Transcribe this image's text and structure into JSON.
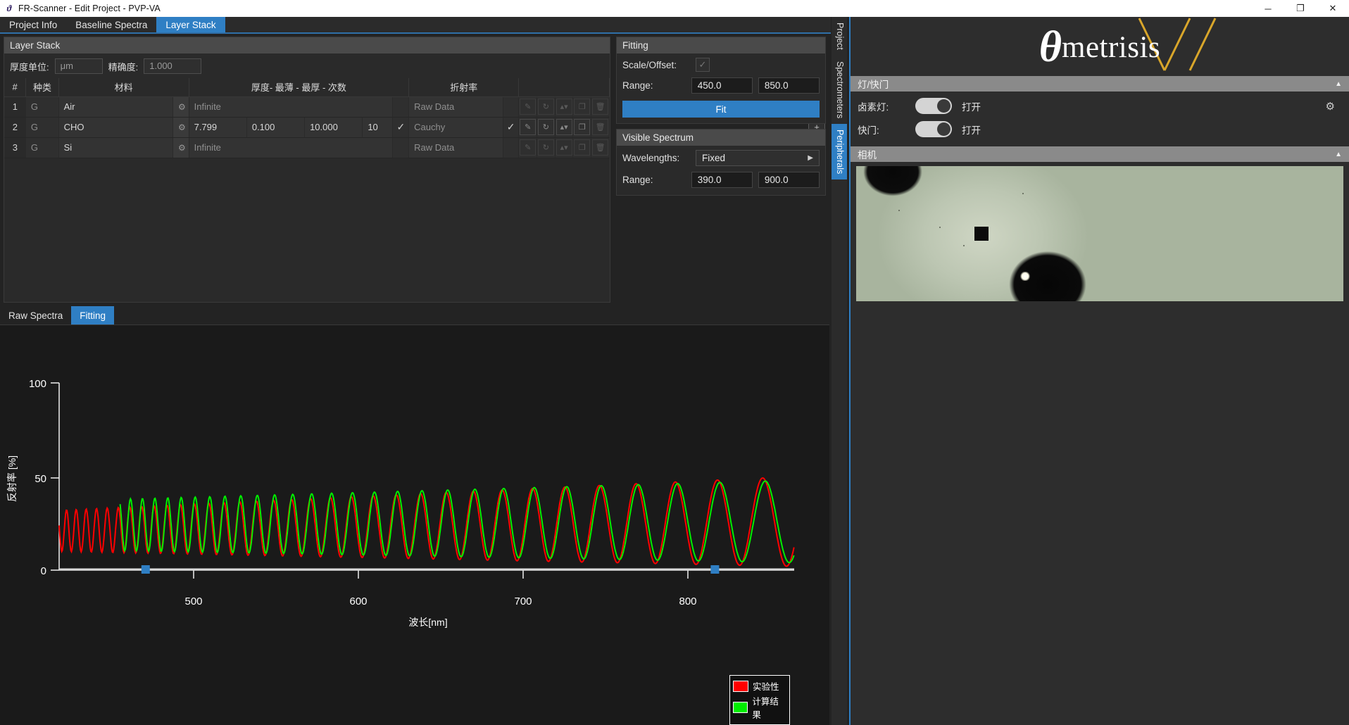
{
  "window": {
    "title": "FR-Scanner - Edit Project - PVP-VA",
    "logo_glyph": "ϑ",
    "minimize": "─",
    "maximize": "❐",
    "close": "✕"
  },
  "tabs": [
    {
      "label": "Project Info",
      "active": false
    },
    {
      "label": "Baseline Spectra",
      "active": false
    },
    {
      "label": "Layer Stack",
      "active": true
    }
  ],
  "layer_stack": {
    "panel_title": "Layer Stack",
    "thickness_unit_label": "厚度单位:",
    "thickness_unit_value": "μm",
    "precision_label": "精确度:",
    "precision_value": "1.000",
    "columns": [
      "#",
      "种类",
      "材料",
      "厚度- 最薄 - 最厚 - 次数",
      "折射率"
    ],
    "rows": [
      {
        "num": "1",
        "kind": "G",
        "material": "Air",
        "thickness": "Infinite",
        "min": "",
        "max": "",
        "count": "",
        "fit_check": false,
        "index": "Raw Data",
        "index_check": false,
        "actions_enabled": false
      },
      {
        "num": "2",
        "kind": "G",
        "material": "CHO",
        "thickness": "7.799",
        "min": "0.100",
        "max": "10.000",
        "count": "10",
        "fit_check": true,
        "index": "Cauchy",
        "index_check": true,
        "actions_enabled": true
      },
      {
        "num": "3",
        "kind": "G",
        "material": "Si",
        "thickness": "Infinite",
        "min": "",
        "max": "",
        "count": "",
        "fit_check": false,
        "index": "Raw Data",
        "index_check": false,
        "actions_enabled": false
      }
    ],
    "row_action_icons": [
      "edit-icon",
      "refresh-icon",
      "spinner-icon",
      "copy-icon",
      "delete-icon"
    ],
    "side_buttons": [
      "add-layer",
      "import-layer",
      "export-layer"
    ]
  },
  "fitting": {
    "title": "Fitting",
    "scale_offset_label": "Scale/Offset:",
    "scale_offset_checked": true,
    "range_label": "Range:",
    "range_min": "450.0",
    "range_max": "850.0",
    "fit_button": "Fit"
  },
  "visible_spectrum": {
    "title": "Visible Spectrum",
    "wavelengths_label": "Wavelengths:",
    "wavelengths_value": "Fixed",
    "range_label": "Range:",
    "range_min": "390.0",
    "range_max": "900.0"
  },
  "vertical_tabs": [
    {
      "label": "Project",
      "active": false
    },
    {
      "label": "Spectrometers",
      "active": false
    },
    {
      "label": "Peripherals",
      "active": true
    }
  ],
  "brand": {
    "theta": "θ",
    "word": "metrisis",
    "ray_color": "#d9a62a"
  },
  "peripherals": {
    "lamp_section": {
      "title": "灯/快门",
      "collapse_icon": "▲",
      "rows": [
        {
          "label": "卤素灯:",
          "state": "打开",
          "on": true
        },
        {
          "label": "快门:",
          "state": "打开",
          "on": true
        }
      ],
      "settings_icon": "⚙"
    },
    "camera_section": {
      "title": "相机",
      "collapse_icon": "▲"
    }
  },
  "chart_tabs": [
    {
      "label": "Raw Spectra",
      "active": false
    },
    {
      "label": "Fitting",
      "active": true
    }
  ],
  "chart_data": {
    "type": "line",
    "title": "",
    "xlabel": "波长[nm]",
    "ylabel": "反射率 [%]",
    "xlim": [
      390,
      900
    ],
    "ylim": [
      0,
      100
    ],
    "xticks": [
      500,
      600,
      700,
      800
    ],
    "yticks": [
      0,
      50,
      100
    ],
    "grid": false,
    "legend_position": "top-right",
    "legend": [
      {
        "name": "实验性",
        "color": "#ff0000"
      },
      {
        "name": "计算结果",
        "color": "#00ee00"
      }
    ],
    "series": [
      {
        "name": "实验性",
        "color": "#ff0000",
        "description": "Measured reflectance interference fringes; amplitude grows from ~20% peak-to-valley at 400nm to ~45% near 900nm, fringe spacing widens with wavelength.",
        "amplitude_start": 11,
        "amplitude_end": 24,
        "baseline_start": 21,
        "baseline_end": 26,
        "phase_offset_deg": 0
      },
      {
        "name": "计算结果",
        "color": "#00ee00",
        "description": "Calculated (Cauchy model, CHO 7.799μm) reflectance; matches experimental fringe period but slightly phase-shifted and truncated below 430nm.",
        "amplitude_start": 13,
        "amplitude_end": 22,
        "baseline_start": 24,
        "baseline_end": 26,
        "phase_offset_deg": 20
      }
    ],
    "scrollbar": {
      "left_handle_x": 450,
      "right_handle_x": 845
    }
  }
}
